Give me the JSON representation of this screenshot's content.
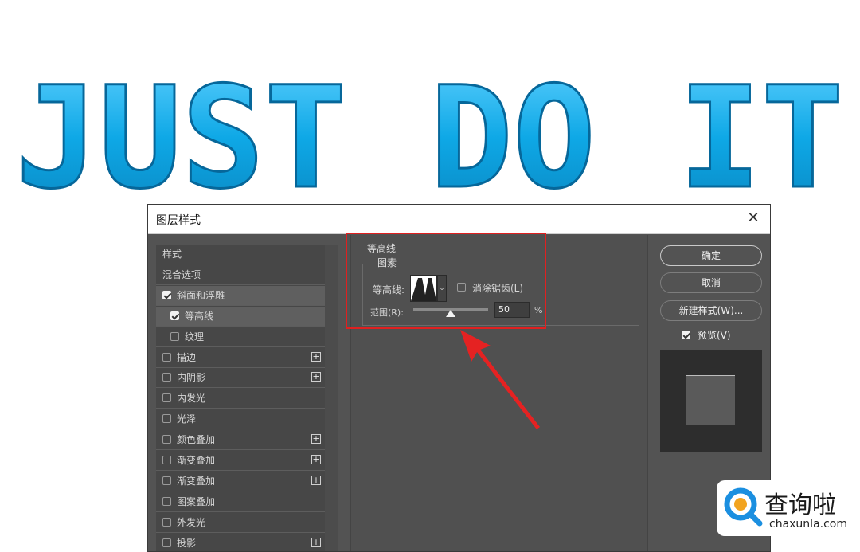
{
  "banner": {
    "text": "JUST DO IT",
    "color": "#0ea8e6"
  },
  "dialog": {
    "title": "图层样式",
    "left_list": [
      {
        "label": "样式",
        "checkbox": false,
        "checked": false,
        "indent": 0,
        "plus": false,
        "selected": false
      },
      {
        "label": "混合选项",
        "checkbox": false,
        "checked": false,
        "indent": 0,
        "plus": false,
        "selected": false
      },
      {
        "label": "斜面和浮雕",
        "checkbox": true,
        "checked": true,
        "indent": 0,
        "plus": false,
        "selected": true
      },
      {
        "label": "等高线",
        "checkbox": true,
        "checked": true,
        "indent": 1,
        "plus": false,
        "selected": true
      },
      {
        "label": "纹理",
        "checkbox": true,
        "checked": false,
        "indent": 1,
        "plus": false,
        "selected": false
      },
      {
        "label": "描边",
        "checkbox": true,
        "checked": false,
        "indent": 0,
        "plus": true,
        "selected": false
      },
      {
        "label": "内阴影",
        "checkbox": true,
        "checked": false,
        "indent": 0,
        "plus": true,
        "selected": false
      },
      {
        "label": "内发光",
        "checkbox": true,
        "checked": false,
        "indent": 0,
        "plus": false,
        "selected": false
      },
      {
        "label": "光泽",
        "checkbox": true,
        "checked": false,
        "indent": 0,
        "plus": false,
        "selected": false
      },
      {
        "label": "颜色叠加",
        "checkbox": true,
        "checked": false,
        "indent": 0,
        "plus": true,
        "selected": false
      },
      {
        "label": "渐变叠加",
        "checkbox": true,
        "checked": false,
        "indent": 0,
        "plus": true,
        "selected": false
      },
      {
        "label": "渐变叠加",
        "checkbox": true,
        "checked": false,
        "indent": 0,
        "plus": true,
        "selected": false
      },
      {
        "label": "图案叠加",
        "checkbox": true,
        "checked": false,
        "indent": 0,
        "plus": false,
        "selected": false
      },
      {
        "label": "外发光",
        "checkbox": true,
        "checked": false,
        "indent": 0,
        "plus": false,
        "selected": false
      },
      {
        "label": "投影",
        "checkbox": true,
        "checked": false,
        "indent": 0,
        "plus": true,
        "selected": false
      }
    ],
    "plus_symbol": "+",
    "center": {
      "section_title": "等高线",
      "group_title": "图素",
      "contour_label": "等高线:",
      "dropdown_symbol": "⌄",
      "anti_alias_label": "消除锯齿(L)",
      "anti_alias_checked": false,
      "range_label": "范围(R):",
      "range_value": "50",
      "range_fraction": 0.5,
      "range_unit": "%"
    },
    "right": {
      "ok": "确定",
      "cancel": "取消",
      "new_style": "新建样式(W)...",
      "preview_label": "预览(V)",
      "preview_checked": true
    }
  },
  "watermark": {
    "name": "查询啦",
    "url": "chaxunla.com"
  },
  "highlight_color": "#e02020"
}
